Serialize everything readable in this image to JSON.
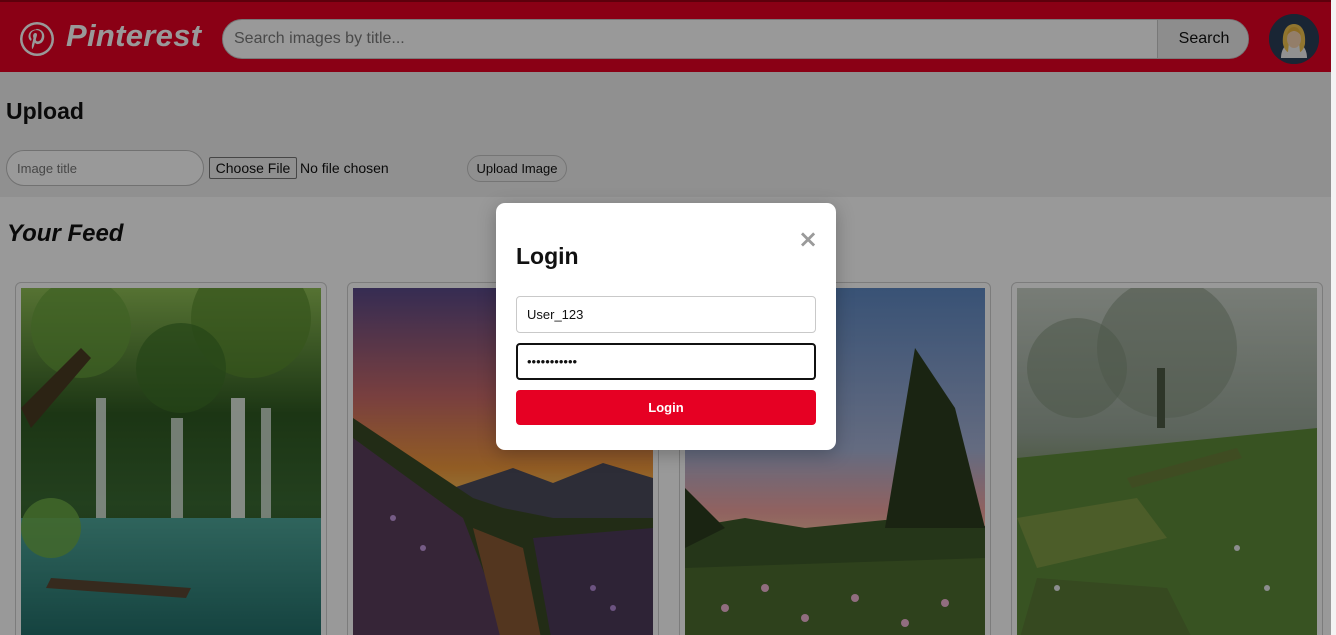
{
  "header": {
    "logo_text": "Pinterest",
    "logo_icon": "pinterest-p-icon",
    "search_placeholder": "Search images by title...",
    "search_button_label": "Search",
    "avatar_icon": "user-avatar-icon"
  },
  "upload": {
    "heading": "Upload",
    "title_placeholder": "Image title",
    "choose_file_label": "Choose File",
    "file_status": "No file chosen",
    "upload_button_label": "Upload Image"
  },
  "feed": {
    "heading": "Your Feed",
    "cards": [
      {
        "image": "waterfall-lake-photo"
      },
      {
        "image": "mountain-sunset-wildflowers-photo"
      },
      {
        "image": "meadow-sunset-photo"
      },
      {
        "image": "misty-forest-moss-photo"
      }
    ]
  },
  "login_modal": {
    "heading": "Login",
    "close_icon": "close-icon",
    "username_value": "User_123",
    "password_value": "•••••••••••",
    "login_button_label": "Login"
  },
  "colors": {
    "brand_red": "#e60023",
    "overlay": "rgba(0,0,0,0.4)"
  }
}
